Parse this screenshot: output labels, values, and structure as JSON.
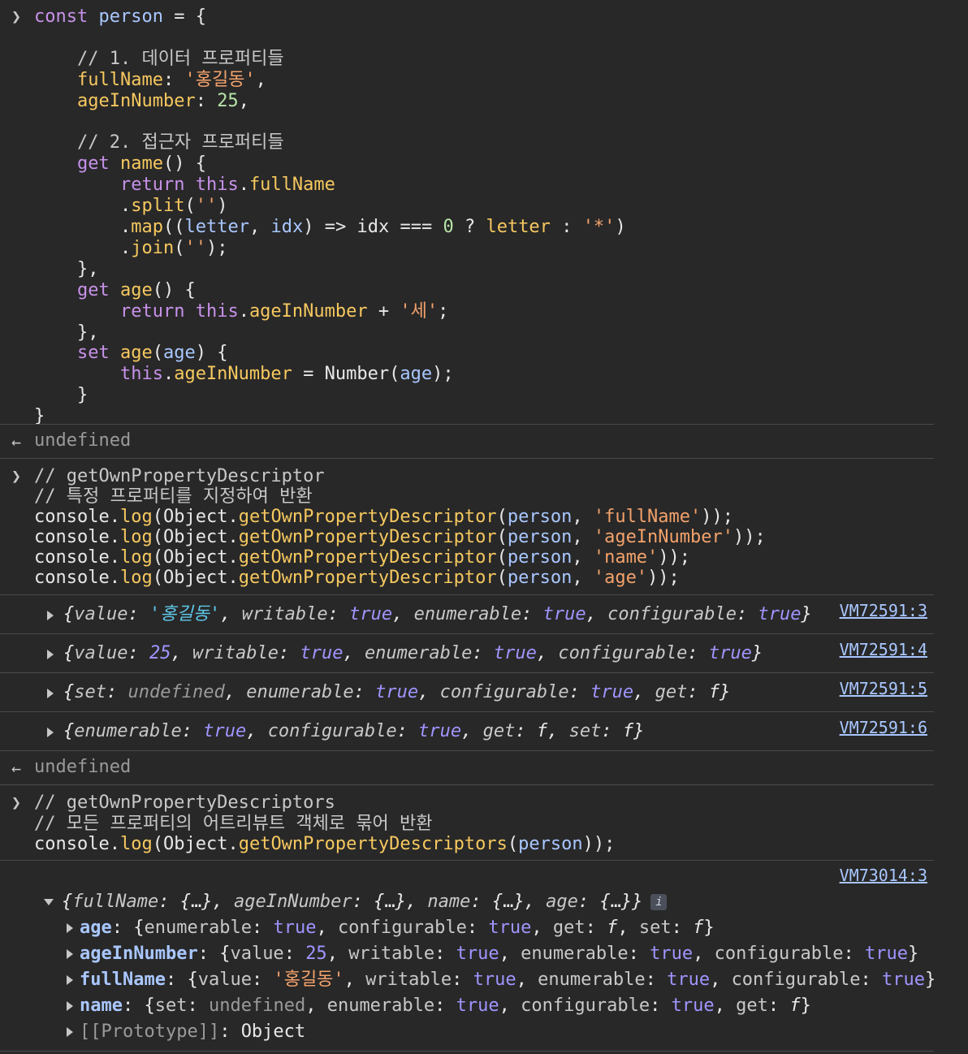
{
  "input1": {
    "lines": [
      "const person = {",
      "",
      "    // 1. 데이터 프로퍼티들",
      "    fullName: '홍길동',",
      "    ageInNumber: 25,",
      "",
      "    // 2. 접근자 프로퍼티들",
      "    get name() {",
      "        return this.fullName",
      "        .split('')",
      "        .map((letter, idx) => idx === 0 ? letter : '*')",
      "        .join('');",
      "    },",
      "    get age() {",
      "        return this.ageInNumber + '세';",
      "    },",
      "    set age(age) {",
      "        this.ageInNumber = Number(age);",
      "    }",
      "}"
    ]
  },
  "result1": "undefined",
  "input2": {
    "lines": [
      "// getOwnPropertyDescriptor",
      "// 특정 프로퍼티를 지정하여 반환",
      "console.log(Object.getOwnPropertyDescriptor(person, 'fullName'));",
      "console.log(Object.getOwnPropertyDescriptor(person, 'ageInNumber'));",
      "console.log(Object.getOwnPropertyDescriptor(person, 'name'));",
      "console.log(Object.getOwnPropertyDescriptor(person, 'age'));"
    ]
  },
  "logs2": [
    {
      "text": "{value: '홍길동', writable: true, enumerable: true, configurable: true}",
      "source": "VM72591:3"
    },
    {
      "text": "{value: 25, writable: true, enumerable: true, configurable: true}",
      "source": "VM72591:4"
    },
    {
      "text": "{set: undefined, enumerable: true, configurable: true, get: f}",
      "source": "VM72591:5"
    },
    {
      "text": "{enumerable: true, configurable: true, get: f, set: f}",
      "source": "VM72591:6"
    }
  ],
  "result2": "undefined",
  "input3": {
    "lines": [
      "// getOwnPropertyDescriptors",
      "// 모든 프로퍼티의 어트리뷰트 객체로 묶어 반환",
      "console.log(Object.getOwnPropertyDescriptors(person));"
    ]
  },
  "log3": {
    "source": "VM73014:3",
    "summary": "{fullName: {…}, ageInNumber: {…}, name: {…}, age: {…}}",
    "info": "i",
    "children": [
      {
        "key": "age",
        "value": "{enumerable: true, configurable: true, get: f, set: f}"
      },
      {
        "key": "ageInNumber",
        "value": "{value: 25, writable: true, enumerable: true, configurable: true}"
      },
      {
        "key": "fullName",
        "value": "{value: '홍길동', writable: true, enumerable: true, configurable: true}"
      },
      {
        "key": "name",
        "value": "{set: undefined, enumerable: true, configurable: true, get: f}"
      },
      {
        "key": "[[Prototype]]",
        "value": "Object"
      }
    ]
  },
  "colors": {
    "background": "#282828",
    "keyword": "#c792ea",
    "property": "#f6c85f",
    "string": "#f3a26b",
    "number": "#b7e4a8",
    "boolean": "#9f95ff",
    "link": "#a9c7ff"
  }
}
